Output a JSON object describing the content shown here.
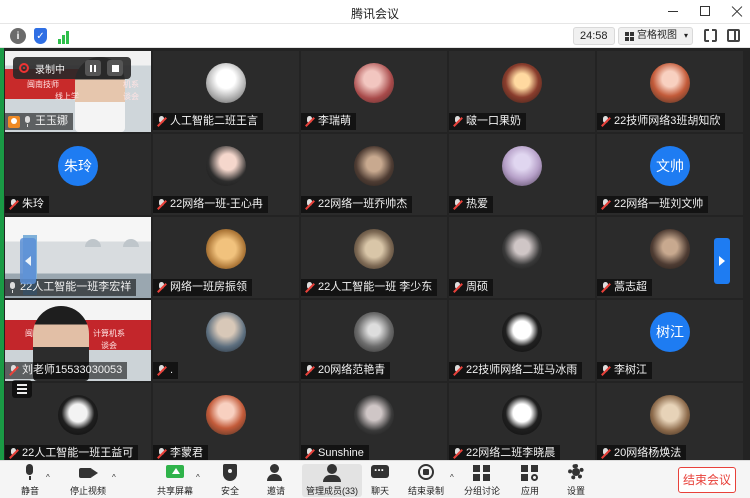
{
  "window": {
    "title": "腾讯会议"
  },
  "infobar": {
    "timer": "24:58",
    "view_mode": "宫格视图"
  },
  "recording": {
    "label": "录制中"
  },
  "tiles": [
    {
      "name": "王玉娜",
      "mic": "on",
      "host": true,
      "kind": "video1",
      "banner_lines": [
        "闽南技师",
        "机系",
        "线上学",
        "谈会"
      ]
    },
    {
      "name": "人工智能二班王言",
      "mic": "off",
      "avatar": "c1"
    },
    {
      "name": "李瑞萌",
      "mic": "off",
      "avatar": "c2"
    },
    {
      "name": "啵一口果奶",
      "mic": "off",
      "avatar": "c3"
    },
    {
      "name": "22技师网络3班胡知欣",
      "mic": "off",
      "avatar": "c4"
    },
    {
      "name": "朱玲",
      "mic": "off",
      "avatar_text": "朱玲"
    },
    {
      "name": "22网络一班-王心冉",
      "mic": "off",
      "avatar": "c5"
    },
    {
      "name": "22网络一班乔帅杰",
      "mic": "off",
      "avatar": "c6"
    },
    {
      "name": "热爱",
      "mic": "off",
      "avatar": "c7"
    },
    {
      "name": "22网络一班刘文帅",
      "mic": "off",
      "avatar_text": "文帅"
    },
    {
      "name": "22人工智能一班李宏祥",
      "mic": "on",
      "kind": "video2"
    },
    {
      "name": "网络一班房振领",
      "mic": "off",
      "avatar": "c8"
    },
    {
      "name": "22人工智能一班 李少东",
      "mic": "off",
      "avatar": "c9"
    },
    {
      "name": "周硕",
      "mic": "off",
      "avatar": "c10"
    },
    {
      "name": "蒿志超",
      "mic": "off",
      "avatar": "c6"
    },
    {
      "name": "刘老师15533030053",
      "mic": "off",
      "kind": "video3",
      "banner_lines": [
        "闽南",
        "计算机系",
        "谈会"
      ]
    },
    {
      "name": ".",
      "mic": "off",
      "avatar": "c12"
    },
    {
      "name": "20网络范艳青",
      "mic": "off",
      "avatar": "c13"
    },
    {
      "name": "22技师网络二班马冰雨",
      "mic": "off",
      "avatar": "c14"
    },
    {
      "name": "李树江",
      "mic": "off",
      "avatar_text": "树江"
    },
    {
      "name": "22人工智能一班王益可",
      "mic": "off",
      "avatar": "c11"
    },
    {
      "name": "李蒙君",
      "mic": "off",
      "avatar": "c4"
    },
    {
      "name": "Sunshine",
      "mic": "off",
      "avatar": "c10"
    },
    {
      "name": "22网络二班李晓晨",
      "mic": "off",
      "avatar": "c14"
    },
    {
      "name": "20网络杨焕法",
      "mic": "off",
      "avatar": "c15"
    }
  ],
  "toolbar": {
    "mute": "静音",
    "stop_video": "停止视频",
    "share_screen": "共享屏幕",
    "security": "安全",
    "invite": "邀请",
    "manage_members": "管理成员(33)",
    "chat": "聊天",
    "end_recording": "结束录制",
    "breakout": "分组讨论",
    "apps": "应用",
    "settings": "设置",
    "end_meeting": "结束会议"
  },
  "colors": {
    "accent": "#1e7cf2",
    "danger": "#e8413a",
    "share_green": "#2fb34a"
  }
}
